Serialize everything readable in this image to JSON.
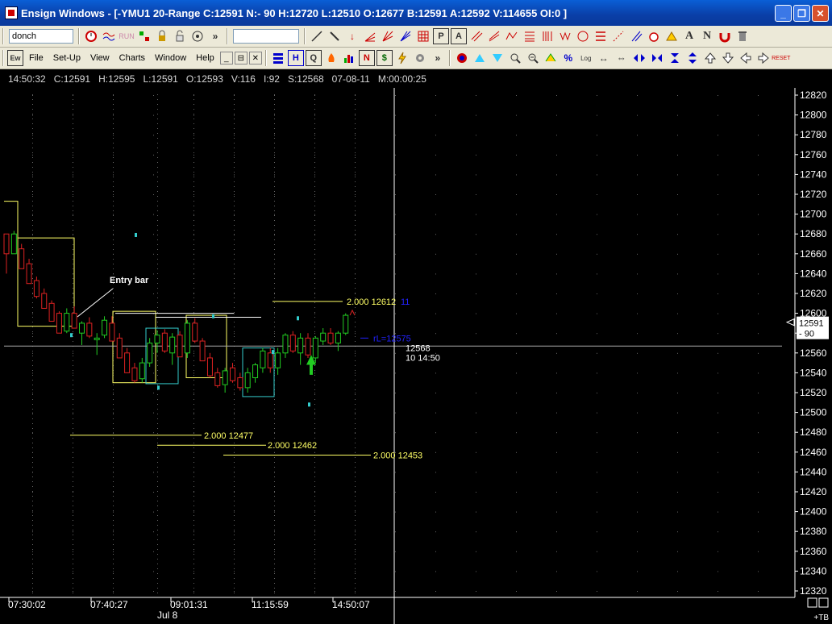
{
  "window": {
    "title": "Ensign Windows - [-YMU1 20-Range C:12591 N:- 90 H:12720 L:12510 O:12677 B:12591 A:12592 V:114655 OI:0 ]",
    "minimize": "_",
    "restore": "❐",
    "close": "✕"
  },
  "toolbar1": {
    "study_combo": "donch",
    "more": "»",
    "property_combo": ""
  },
  "menu": {
    "items": [
      "File",
      "Set-Up",
      "View",
      "Charts",
      "Window",
      "Help"
    ],
    "mdi": [
      "_",
      "⊟",
      "✕"
    ]
  },
  "infoline": {
    "time": "14:50:32",
    "close": "C:12591",
    "high": "H:12595",
    "low": "L:12591",
    "open": "O:12593",
    "volume": "V:116",
    "i": "I:92",
    "s": "S:12568",
    "date": "07-08-11",
    "m": "M:00:00:25"
  },
  "chart_data": {
    "type": "candlestick",
    "symbol": "YMU1",
    "bar_type": "20-Range",
    "y_ticks": [
      12820,
      12800,
      12780,
      12760,
      12740,
      12720,
      12700,
      12680,
      12660,
      12640,
      12620,
      12600,
      12580,
      12560,
      12540,
      12520,
      12500,
      12480,
      12460,
      12440,
      12420,
      12400,
      12380,
      12360,
      12340,
      12320
    ],
    "x_ticks": [
      "07:30:02",
      "07:40:27",
      "09:01:31",
      "11:15:59",
      "14:50:07"
    ],
    "x_date_label": "Jul 8",
    "last_price": "12591",
    "net_change": "- 90",
    "annotations": {
      "entry_label": "Entry bar",
      "level_upper": "2.000  12612",
      "level_upper_suffix": "11",
      "rl_label": "rL=12575",
      "level1": "2.000  12477",
      "level2": "2.000  12462",
      "level3": "2.000  12453",
      "cursor_price": "12568",
      "cursor_time": "10  14:50"
    },
    "corner_label": "+TB",
    "candles": [
      {
        "o": 12660,
        "h": 12680,
        "l": 12640,
        "c": 12680,
        "up": false
      },
      {
        "o": 12680,
        "h": 12683,
        "l": 12660,
        "c": 12660,
        "up": true
      },
      {
        "o": 12665,
        "h": 12670,
        "l": 12645,
        "c": 12645,
        "up": false
      },
      {
        "o": 12650,
        "h": 12655,
        "l": 12630,
        "c": 12630,
        "up": false
      },
      {
        "o": 12633,
        "h": 12637,
        "l": 12615,
        "c": 12617,
        "up": false
      },
      {
        "o": 12620,
        "h": 12625,
        "l": 12605,
        "c": 12605,
        "up": false
      },
      {
        "o": 12610,
        "h": 12613,
        "l": 12592,
        "c": 12592,
        "up": false
      },
      {
        "o": 12600,
        "h": 12602,
        "l": 12580,
        "c": 12580,
        "up": false
      },
      {
        "o": 12582,
        "h": 12605,
        "l": 12580,
        "c": 12600,
        "up": true
      },
      {
        "o": 12600,
        "h": 12607,
        "l": 12585,
        "c": 12585,
        "up": false
      },
      {
        "o": 12580,
        "h": 12592,
        "l": 12568,
        "c": 12590,
        "up": true
      },
      {
        "o": 12590,
        "h": 12596,
        "l": 12575,
        "c": 12577,
        "up": false
      },
      {
        "o": 12575,
        "h": 12580,
        "l": 12558,
        "c": 12575,
        "up": true
      },
      {
        "o": 12578,
        "h": 12597,
        "l": 12575,
        "c": 12593,
        "up": true
      },
      {
        "o": 12590,
        "h": 12597,
        "l": 12572,
        "c": 12572,
        "up": false
      },
      {
        "o": 12575,
        "h": 12580,
        "l": 12555,
        "c": 12555,
        "up": false
      },
      {
        "o": 12560,
        "h": 12565,
        "l": 12540,
        "c": 12540,
        "up": false
      },
      {
        "o": 12545,
        "h": 12550,
        "l": 12530,
        "c": 12532,
        "up": false
      },
      {
        "o": 12534,
        "h": 12555,
        "l": 12530,
        "c": 12550,
        "up": true
      },
      {
        "o": 12550,
        "h": 12575,
        "l": 12546,
        "c": 12570,
        "up": true
      },
      {
        "o": 12570,
        "h": 12583,
        "l": 12560,
        "c": 12578,
        "up": true
      },
      {
        "o": 12580,
        "h": 12584,
        "l": 12560,
        "c": 12562,
        "up": false
      },
      {
        "o": 12560,
        "h": 12580,
        "l": 12548,
        "c": 12576,
        "up": true
      },
      {
        "o": 12578,
        "h": 12582,
        "l": 12556,
        "c": 12556,
        "up": false
      },
      {
        "o": 12560,
        "h": 12593,
        "l": 12555,
        "c": 12590,
        "up": true
      },
      {
        "o": 12590,
        "h": 12595,
        "l": 12570,
        "c": 12572,
        "up": false
      },
      {
        "o": 12572,
        "h": 12575,
        "l": 12552,
        "c": 12552,
        "up": false
      },
      {
        "o": 12555,
        "h": 12560,
        "l": 12535,
        "c": 12537,
        "up": false
      },
      {
        "o": 12540,
        "h": 12545,
        "l": 12525,
        "c": 12527,
        "up": false
      },
      {
        "o": 12528,
        "h": 12545,
        "l": 12520,
        "c": 12542,
        "up": true
      },
      {
        "o": 12545,
        "h": 12550,
        "l": 12530,
        "c": 12532,
        "up": false
      },
      {
        "o": 12535,
        "h": 12540,
        "l": 12522,
        "c": 12525,
        "up": false
      },
      {
        "o": 12525,
        "h": 12545,
        "l": 12520,
        "c": 12540,
        "up": true
      },
      {
        "o": 12535,
        "h": 12550,
        "l": 12530,
        "c": 12548,
        "up": true
      },
      {
        "o": 12545,
        "h": 12565,
        "l": 12540,
        "c": 12562,
        "up": true
      },
      {
        "o": 12560,
        "h": 12565,
        "l": 12540,
        "c": 12545,
        "up": false
      },
      {
        "o": 12545,
        "h": 12565,
        "l": 12538,
        "c": 12560,
        "up": true
      },
      {
        "o": 12560,
        "h": 12580,
        "l": 12555,
        "c": 12578,
        "up": true
      },
      {
        "o": 12578,
        "h": 12582,
        "l": 12560,
        "c": 12562,
        "up": false
      },
      {
        "o": 12560,
        "h": 12580,
        "l": 12548,
        "c": 12575,
        "up": true
      },
      {
        "o": 12575,
        "h": 12580,
        "l": 12555,
        "c": 12558,
        "up": false
      },
      {
        "o": 12555,
        "h": 12577,
        "l": 12550,
        "c": 12575,
        "up": true
      },
      {
        "o": 12572,
        "h": 12585,
        "l": 12568,
        "c": 12580,
        "up": true
      },
      {
        "o": 12580,
        "h": 12585,
        "l": 12568,
        "c": 12570,
        "up": false
      },
      {
        "o": 12570,
        "h": 12582,
        "l": 12562,
        "c": 12580,
        "up": true
      },
      {
        "o": 12580,
        "h": 12600,
        "l": 12578,
        "c": 12598,
        "up": true
      }
    ]
  },
  "colors": {
    "up": "#22cc22",
    "down": "#dd2222",
    "level": "#ffff66",
    "box_yellow": "#ffff66",
    "box_cyan": "#33cccc",
    "grid_dot": "#666666",
    "axis_text": "#ffffff",
    "blue_text": "#2222ff"
  }
}
